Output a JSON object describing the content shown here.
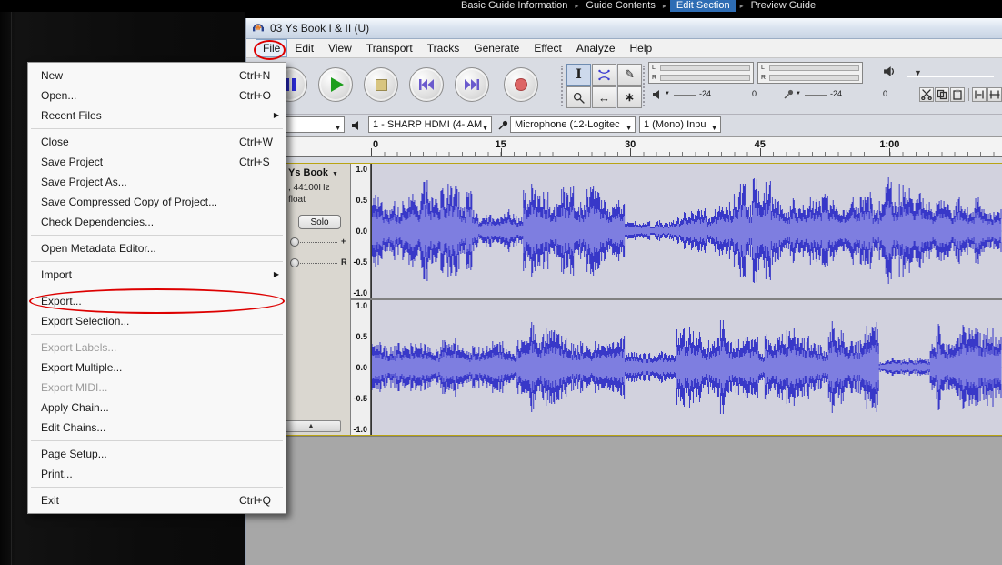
{
  "colors": {
    "annotation_red": "#dd0000",
    "breadcrumb_active_bg": "#2e6db4",
    "waveform_blue": "#3838c8",
    "waveform_rms": "#7e7ee0"
  },
  "breadcrumb": {
    "items": [
      "Basic Guide Information",
      "Guide Contents",
      "Edit Section",
      "Preview Guide"
    ],
    "active_index": 2
  },
  "window": {
    "title": "03 Ys Book I & II (U)"
  },
  "menubar": {
    "items": [
      "File",
      "Edit",
      "View",
      "Transport",
      "Tracks",
      "Generate",
      "Effect",
      "Analyze",
      "Help"
    ],
    "open_index": 0
  },
  "file_menu": {
    "items": [
      {
        "label": "New",
        "shortcut": "Ctrl+N"
      },
      {
        "label": "Open...",
        "shortcut": "Ctrl+O"
      },
      {
        "label": "Recent Files",
        "submenu": true
      },
      {
        "separator": true
      },
      {
        "label": "Close",
        "shortcut": "Ctrl+W"
      },
      {
        "label": "Save Project",
        "shortcut": "Ctrl+S"
      },
      {
        "label": "Save Project As..."
      },
      {
        "label": "Save Compressed Copy of Project..."
      },
      {
        "label": "Check Dependencies..."
      },
      {
        "separator": true
      },
      {
        "label": "Open Metadata Editor..."
      },
      {
        "separator": true
      },
      {
        "label": "Import",
        "submenu": true
      },
      {
        "separator": true
      },
      {
        "label": "Export...",
        "annotated": true
      },
      {
        "label": "Export Selection..."
      },
      {
        "separator": true
      },
      {
        "label": "Export Labels...",
        "disabled": true
      },
      {
        "label": "Export Multiple..."
      },
      {
        "label": "Export MIDI...",
        "disabled": true
      },
      {
        "label": "Apply Chain..."
      },
      {
        "label": "Edit Chains..."
      },
      {
        "separator": true
      },
      {
        "label": "Page Setup..."
      },
      {
        "label": "Print..."
      },
      {
        "separator": true
      },
      {
        "label": "Exit",
        "shortcut": "Ctrl+Q"
      }
    ]
  },
  "meters": {
    "left_label": "L",
    "right_label": "R",
    "scale": [
      "-24",
      "0"
    ]
  },
  "device_toolbar": {
    "output_device": "1 - SHARP HDMI (4- AM",
    "input_device": "Microphone (12-Logitec",
    "input_channels": "1 (Mono) Inpu"
  },
  "timeline": {
    "ticks": [
      "0",
      "15",
      "30",
      "45",
      "1:00"
    ]
  },
  "track": {
    "name": "Ys Book",
    "rate": ", 44100Hz",
    "format": "float",
    "solo": "Solo",
    "gain_right_label": "+",
    "pan_right_label": "R",
    "scale": [
      "1.0",
      "0.5",
      "0.0",
      "-0.5",
      "-1.0"
    ]
  },
  "icons": {
    "dropdown_arrow": "▼",
    "submenu_arrow": "▶",
    "breadcrumb_separator": "▸",
    "collapse_arrow": "▲",
    "timeshift_tool": "↔",
    "multi_tool": "∗",
    "draw_tool": "✎",
    "selection_tool": "I"
  }
}
